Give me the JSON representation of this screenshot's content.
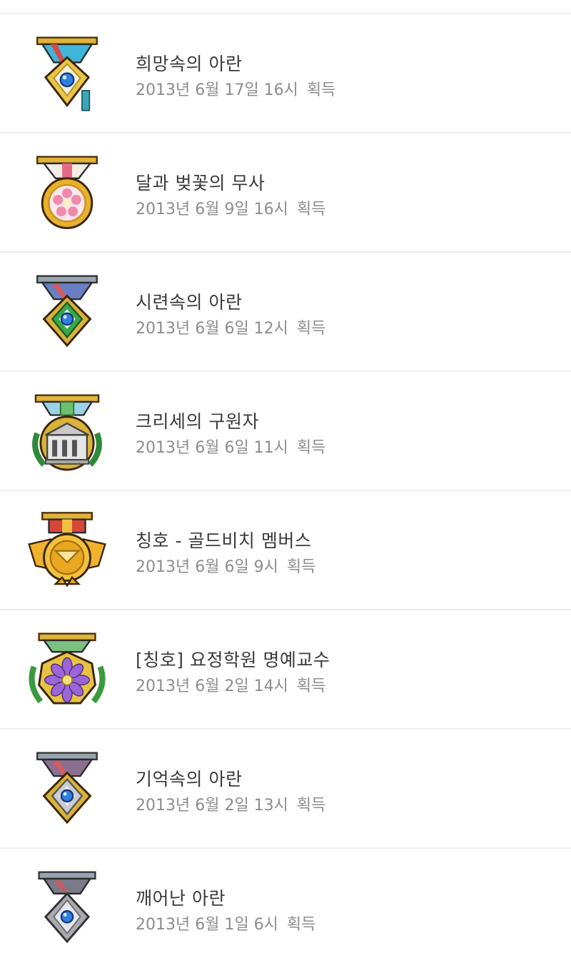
{
  "achievements": [
    {
      "title": "희망속의 아란",
      "date": "2013년 6월 17일 16시",
      "status": "획득",
      "medal": "sapphire-gold-medal-icon"
    },
    {
      "title": "달과 벚꽃의 무사",
      "date": "2013년 6월 9일 16시",
      "status": "획득",
      "medal": "cherry-blossom-medal-icon"
    },
    {
      "title": "시련속의 아란",
      "date": "2013년 6월 6일 12시",
      "status": "획득",
      "medal": "sapphire-green-medal-icon"
    },
    {
      "title": "크리세의 구원자",
      "date": "2013년 6월 6일 11시",
      "status": "획득",
      "medal": "temple-laurel-medal-icon"
    },
    {
      "title": "칭호 - 골드비치 멤버스",
      "date": "2013년 6월 6일 9시",
      "status": "획득",
      "medal": "gold-winged-medal-icon"
    },
    {
      "title": "[칭호] 요정학원 명예교수",
      "date": "2013년 6월 2일 14시",
      "status": "획득",
      "medal": "purple-flower-medal-icon"
    },
    {
      "title": "기억속의 아란",
      "date": "2013년 6월 2일 13시",
      "status": "획득",
      "medal": "sapphire-silver-medal-icon"
    },
    {
      "title": "깨어난 아란",
      "date": "2013년 6월 1일 6시",
      "status": "획득",
      "medal": "sapphire-plain-medal-icon"
    }
  ]
}
